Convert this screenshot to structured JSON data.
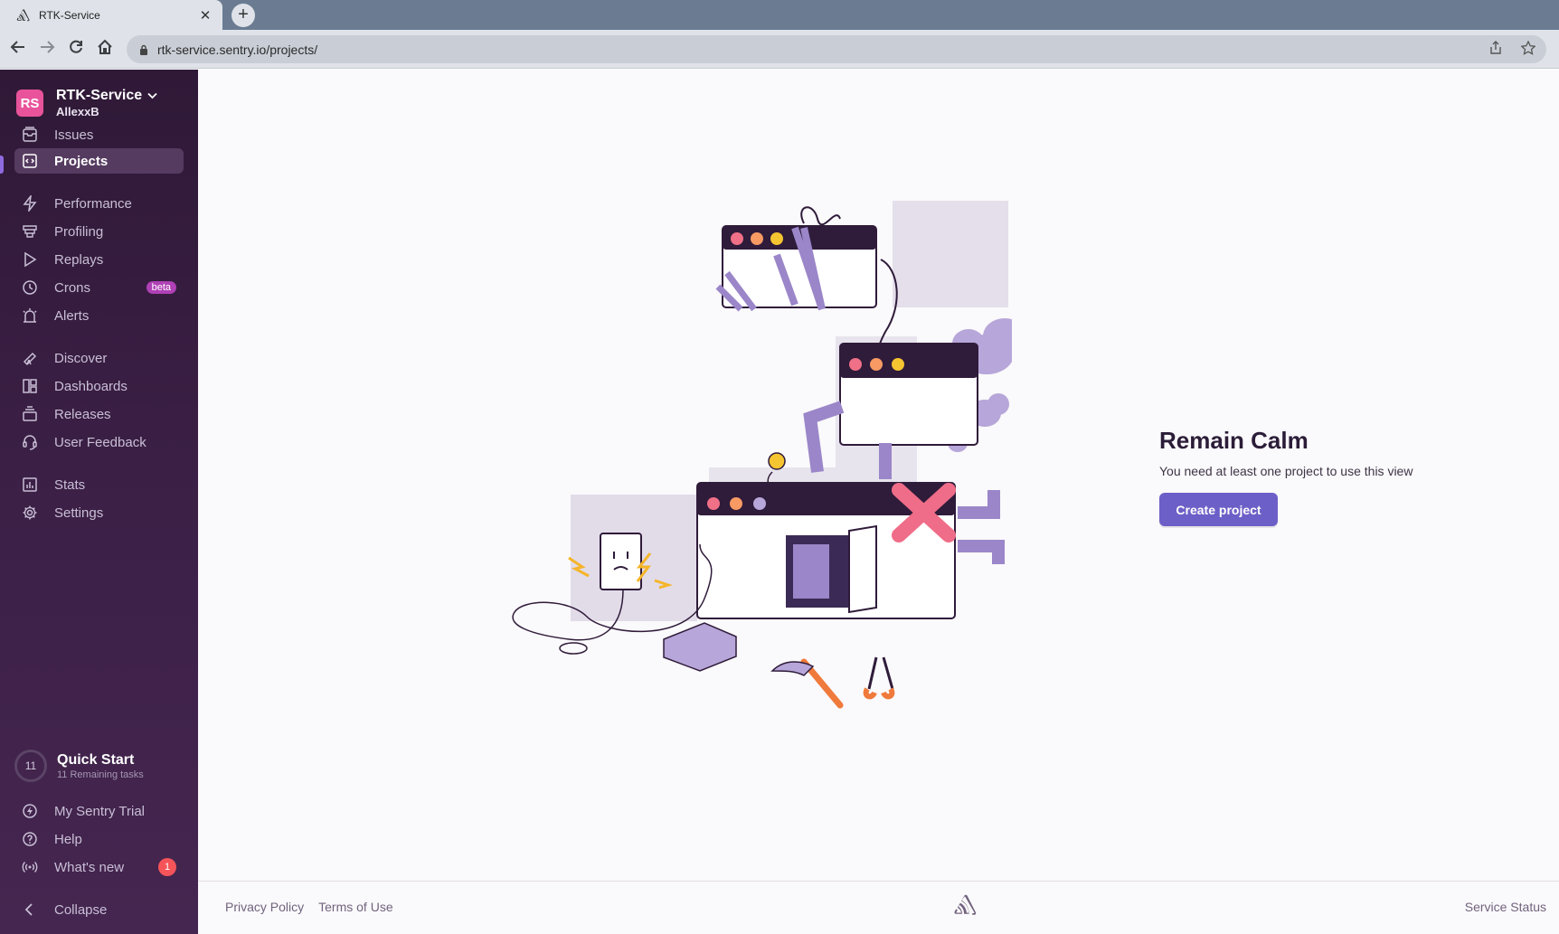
{
  "browser": {
    "tab_title": "RTK-Service",
    "tab_close": "✕",
    "new_tab": "+",
    "url": "rtk-service.sentry.io/projects/"
  },
  "org": {
    "initials": "RS",
    "name": "RTK-Service",
    "user": "AllexxB",
    "avatar_color": "#e9539b"
  },
  "sidebar": {
    "items": [
      {
        "label": "Issues",
        "icon": "issues-icon"
      },
      {
        "label": "Projects",
        "icon": "projects-icon",
        "active": true
      },
      {
        "label": "Performance",
        "icon": "performance-icon"
      },
      {
        "label": "Profiling",
        "icon": "profiling-icon"
      },
      {
        "label": "Replays",
        "icon": "replays-icon"
      },
      {
        "label": "Crons",
        "icon": "crons-icon",
        "badge": "beta"
      },
      {
        "label": "Alerts",
        "icon": "alerts-icon"
      },
      {
        "label": "Discover",
        "icon": "discover-icon"
      },
      {
        "label": "Dashboards",
        "icon": "dashboards-icon"
      },
      {
        "label": "Releases",
        "icon": "releases-icon"
      },
      {
        "label": "User Feedback",
        "icon": "user-feedback-icon"
      },
      {
        "label": "Stats",
        "icon": "stats-icon"
      },
      {
        "label": "Settings",
        "icon": "settings-icon"
      }
    ],
    "quick_start": {
      "count": "11",
      "title": "Quick Start",
      "subtitle": "11 Remaining tasks"
    },
    "bottom": [
      {
        "label": "My Sentry Trial",
        "icon": "trial-icon"
      },
      {
        "label": "Help",
        "icon": "help-icon"
      },
      {
        "label": "What's new",
        "icon": "broadcast-icon",
        "badge": "1"
      },
      {
        "label": "Collapse",
        "icon": "collapse-icon"
      }
    ]
  },
  "empty_state": {
    "title": "Remain Calm",
    "description": "You need at least one project to use this view",
    "button": "Create project"
  },
  "footer": {
    "privacy": "Privacy Policy",
    "terms": "Terms of Use",
    "status": "Service Status"
  },
  "colors": {
    "accent": "#6c5fc7",
    "sidebar_bg": "#3b1f45",
    "beta_badge": "#b040b6",
    "count_badge": "#f55459"
  }
}
